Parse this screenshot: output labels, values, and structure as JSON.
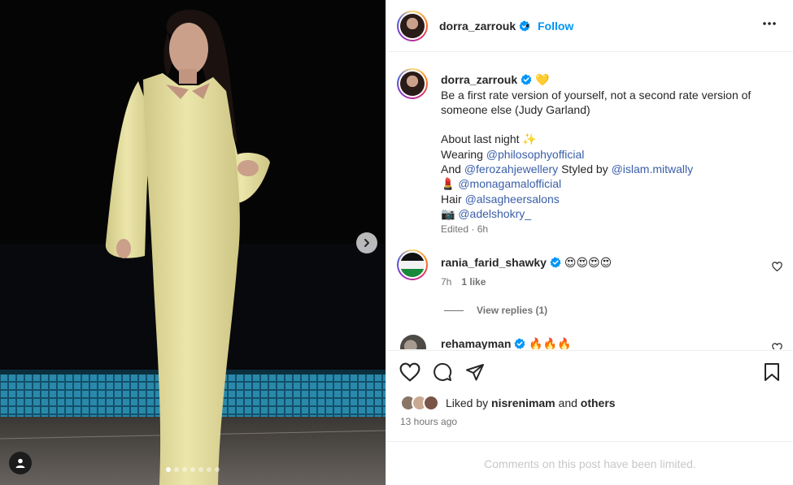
{
  "post": {
    "username": "dorra_zarrouk",
    "separator": "•",
    "follow_label": "Follow",
    "carousel": {
      "slide_count": 7,
      "active_index": 0
    }
  },
  "caption": {
    "username": "dorra_zarrouk",
    "heart_emoji": "💛",
    "line1": "Be a first rate version of yourself, not a second rate version of",
    "line2": "someone else (Judy Garland)",
    "about": "About last night",
    "about_emoji": "✨",
    "wearing_prefix": "Wearing",
    "wearing_mention": "@philosophyofficial",
    "and_prefix": "And",
    "and_mention": "@ferozahjewellery",
    "styled_by": "Styled by",
    "stylist_mention": "@islam.mitwally",
    "lipstick_emoji": "💄",
    "makeup_mention": "@monagamalofficial",
    "hair_prefix": "Hair",
    "hair_mention": "@alsagheersalons",
    "camera_emoji": "📷",
    "photo_mention": "@adelshokry_",
    "time": "Edited · 6h"
  },
  "comments": [
    {
      "username": "rania_farid_shawky",
      "text": "😍😍😍😍",
      "time": "7h",
      "likes": "1 like",
      "view_replies": "View replies (1)"
    },
    {
      "username": "rehamayman",
      "text": "🔥🔥🔥"
    }
  ],
  "likes": {
    "prefix": "Liked by",
    "user": "nisrenimam",
    "middle": "and",
    "others": "others"
  },
  "post_time": "13 hours ago",
  "comments_limited": "Comments on this post have been limited.",
  "colors": {
    "accent": "#0095f6",
    "mention": "#3a5ea8",
    "dress": "#e9e3a4",
    "pool": "#1e6f8e"
  }
}
